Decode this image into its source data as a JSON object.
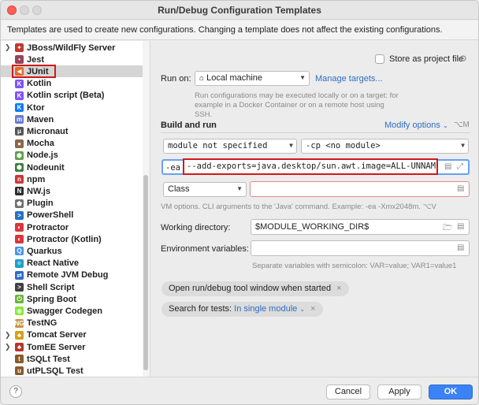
{
  "window": {
    "title": "Run/Debug Configuration Templates"
  },
  "banner": {
    "text": "Templates are used to create new configurations. Changing a template does not affect the existing configurations."
  },
  "sidebar": {
    "items": [
      {
        "label": "JBoss/WildFly Server",
        "icon": "jboss-icon",
        "color": "#c0392b",
        "glyph": "✦",
        "expandable": true
      },
      {
        "label": "Jest",
        "icon": "jest-icon",
        "color": "#99425b",
        "glyph": "•",
        "expandable": false
      },
      {
        "label": "JUnit",
        "icon": "junit-icon",
        "color": "#e26a2c",
        "glyph": "◀",
        "expandable": false,
        "selected": true
      },
      {
        "label": "Kotlin",
        "icon": "kotlin-icon",
        "color": "#7f52ff",
        "glyph": "K",
        "expandable": false
      },
      {
        "label": "Kotlin script (Beta)",
        "icon": "kotlin-script-icon",
        "color": "#7f52ff",
        "glyph": "K",
        "expandable": false
      },
      {
        "label": "Ktor",
        "icon": "ktor-icon",
        "color": "#087cfa",
        "glyph": "K",
        "expandable": false
      },
      {
        "label": "Maven",
        "icon": "maven-icon",
        "color": "#6b7ad6",
        "glyph": "m",
        "expandable": false
      },
      {
        "label": "Micronaut",
        "icon": "micronaut-icon",
        "color": "#555555",
        "glyph": "μ",
        "expandable": false
      },
      {
        "label": "Mocha",
        "icon": "mocha-icon",
        "color": "#8d6748",
        "glyph": "●",
        "expandable": false
      },
      {
        "label": "Node.js",
        "icon": "nodejs-icon",
        "color": "#5fa04e",
        "glyph": "⬢",
        "expandable": false
      },
      {
        "label": "Nodeunit",
        "icon": "nodeunit-icon",
        "color": "#3e7f3c",
        "glyph": "⬢",
        "expandable": false
      },
      {
        "label": "npm",
        "icon": "npm-icon",
        "color": "#cb3837",
        "glyph": "n",
        "expandable": false
      },
      {
        "label": "NW.js",
        "icon": "nwjs-icon",
        "color": "#2b2b2b",
        "glyph": "N",
        "expandable": false
      },
      {
        "label": "Plugin",
        "icon": "plugin-icon",
        "color": "#6f6f6f",
        "glyph": "⬟",
        "expandable": false
      },
      {
        "label": "PowerShell",
        "icon": "powershell-icon",
        "color": "#2671be",
        "glyph": ">",
        "expandable": false
      },
      {
        "label": "Protractor",
        "icon": "protractor-icon",
        "color": "#d9363e",
        "glyph": "◐",
        "expandable": false
      },
      {
        "label": "Protractor (Kotlin)",
        "icon": "protractor-kotlin-icon",
        "color": "#d9363e",
        "glyph": "◐",
        "expandable": false
      },
      {
        "label": "Quarkus",
        "icon": "quarkus-icon",
        "color": "#4695eb",
        "glyph": "Q",
        "expandable": false
      },
      {
        "label": "React Native",
        "icon": "react-native-icon",
        "color": "#1ea0c7",
        "glyph": "⚛",
        "expandable": false
      },
      {
        "label": "Remote JVM Debug",
        "icon": "remote-debug-icon",
        "color": "#2f6ec4",
        "glyph": "⇄",
        "expandable": false
      },
      {
        "label": "Shell Script",
        "icon": "shell-script-icon",
        "color": "#404040",
        "glyph": ">",
        "expandable": false
      },
      {
        "label": "Spring Boot",
        "icon": "spring-boot-icon",
        "color": "#6db33f",
        "glyph": "⏻",
        "expandable": false
      },
      {
        "label": "Swagger Codegen",
        "icon": "swagger-icon",
        "color": "#85ea2d",
        "glyph": "◉",
        "expandable": false
      },
      {
        "label": "TestNG",
        "icon": "testng-icon",
        "color": "#c99542",
        "glyph": "NG",
        "expandable": false
      },
      {
        "label": "Tomcat Server",
        "icon": "tomcat-icon",
        "color": "#d1a31b",
        "glyph": "♣",
        "expandable": true
      },
      {
        "label": "TomEE Server",
        "icon": "tomee-icon",
        "color": "#b4362e",
        "glyph": "♣",
        "expandable": true
      },
      {
        "label": "tSQLt Test",
        "icon": "tsqlt-icon",
        "color": "#8a5a2b",
        "glyph": "t",
        "expandable": false
      },
      {
        "label": "utPLSQL Test",
        "icon": "utplsql-icon",
        "color": "#8a5a2b",
        "glyph": "u",
        "expandable": false
      }
    ]
  },
  "form": {
    "store_as_project_file": "Store as project file",
    "run_on_label": "Run on:",
    "run_on_value": "Local machine",
    "manage_targets": "Manage targets...",
    "run_on_hint": "Run configurations may be executed locally or on a target: for example in a Docker Container or on a remote host using SSH.",
    "build_and_run": "Build and run",
    "modify_options": "Modify options",
    "modify_options_shortcut": "⌥M",
    "module_select": "module not specified",
    "cp_select": "-cp <no module>",
    "vm_prefix": "-ea",
    "vm_options": "--add-exports=java.desktop/sun.awt.image=ALL-UNNAMED",
    "test_kind": "Class",
    "class_value": "",
    "vm_hint": "VM options. CLI arguments to the 'Java' command. Example: -ea -Xmx2048m. ⌥V",
    "working_dir_label": "Working directory:",
    "working_dir_value": "$MODULE_WORKING_DIR$",
    "env_vars_label": "Environment variables:",
    "env_vars_value": "",
    "env_vars_hint": "Separate variables with semicolon: VAR=value; VAR1=value1",
    "chip_open_tool_window": "Open run/debug tool window when started",
    "chip_search_label": "Search for tests:",
    "chip_search_value": "In single module"
  },
  "footer": {
    "help": "?",
    "cancel": "Cancel",
    "apply": "Apply",
    "ok": "OK"
  }
}
